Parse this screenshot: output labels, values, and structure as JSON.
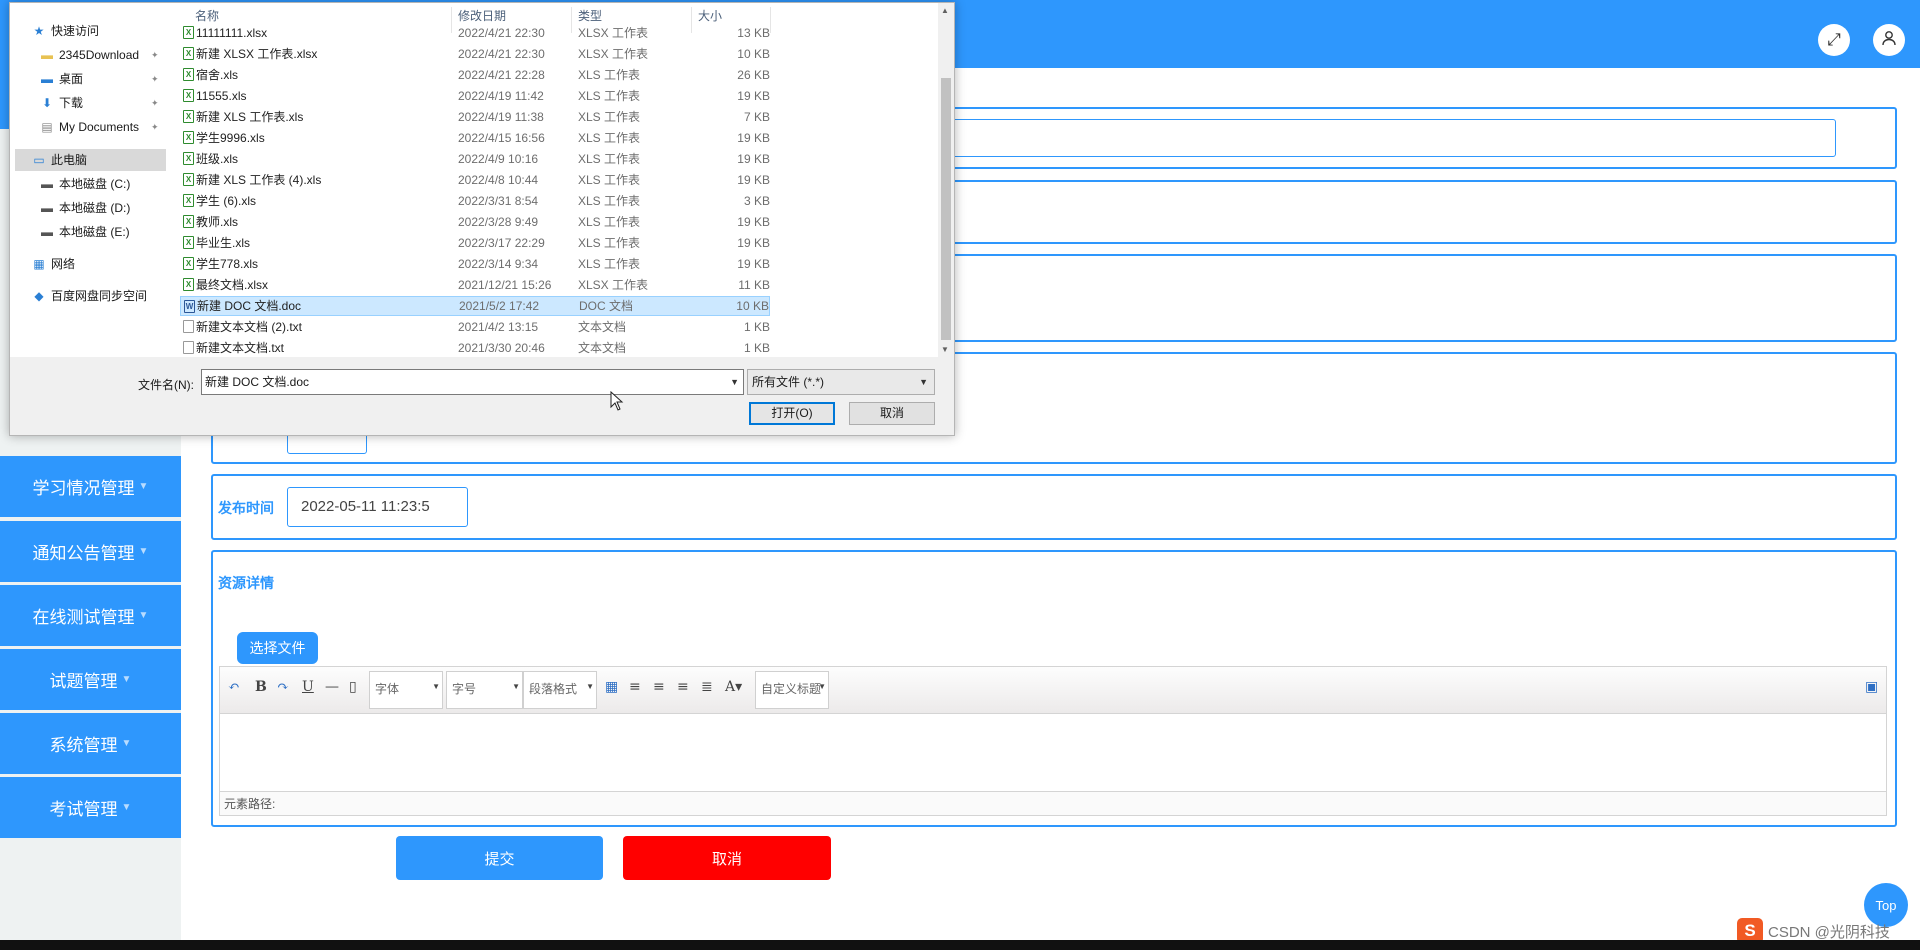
{
  "header": {
    "fullscreen_icon": "expand-icon",
    "user_icon": "user-icon"
  },
  "sidebar": {
    "items": [
      {
        "label": "学习情况管理"
      },
      {
        "label": "通知公告管理"
      },
      {
        "label": "在线测试管理"
      },
      {
        "label": "试题管理"
      },
      {
        "label": "系统管理"
      },
      {
        "label": "考试管理"
      }
    ]
  },
  "form": {
    "publish_time_label": "发布时间",
    "publish_time_value": "2022-05-11 11:23:5",
    "detail_label": "资源详情",
    "choose_file_label": "选择文件",
    "submit_label": "提交",
    "cancel_label": "取消"
  },
  "editor": {
    "font_family_placeholder": "字体",
    "font_size_placeholder": "字号",
    "paragraph_placeholder": "段落格式",
    "custom_title_placeholder": "自定义标题",
    "element_path_label": "元素路径:"
  },
  "top_button": "Top",
  "watermark": "CSDN @光阴科技",
  "dialog": {
    "nav": {
      "quick_access": "快速访问",
      "pinned": [
        "2345Download",
        "桌面",
        "下载",
        "My Documents"
      ],
      "this_pc": "此电脑",
      "drives": [
        "本地磁盘 (C:)",
        "本地磁盘 (D:)",
        "本地磁盘 (E:)"
      ],
      "network": "网络",
      "baidu": "百度网盘同步空间"
    },
    "columns": {
      "name": "名称",
      "date": "修改日期",
      "type": "类型",
      "size": "大小"
    },
    "files": [
      {
        "name": "11111111.xlsx",
        "date": "2022/4/21 22:30",
        "type": "XLSX 工作表",
        "size": "13 KB",
        "kind": "xlsx"
      },
      {
        "name": "新建 XLSX 工作表.xlsx",
        "date": "2022/4/21 22:30",
        "type": "XLSX 工作表",
        "size": "10 KB",
        "kind": "xlsx"
      },
      {
        "name": "宿舍.xls",
        "date": "2022/4/21 22:28",
        "type": "XLS 工作表",
        "size": "26 KB",
        "kind": "xls"
      },
      {
        "name": "11555.xls",
        "date": "2022/4/19 11:42",
        "type": "XLS 工作表",
        "size": "19 KB",
        "kind": "xls"
      },
      {
        "name": "新建 XLS 工作表.xls",
        "date": "2022/4/19 11:38",
        "type": "XLS 工作表",
        "size": "7 KB",
        "kind": "xls"
      },
      {
        "name": "学生9996.xls",
        "date": "2022/4/15 16:56",
        "type": "XLS 工作表",
        "size": "19 KB",
        "kind": "xls"
      },
      {
        "name": "班级.xls",
        "date": "2022/4/9 10:16",
        "type": "XLS 工作表",
        "size": "19 KB",
        "kind": "xls"
      },
      {
        "name": "新建 XLS 工作表 (4).xls",
        "date": "2022/4/8 10:44",
        "type": "XLS 工作表",
        "size": "19 KB",
        "kind": "xls"
      },
      {
        "name": "学生 (6).xls",
        "date": "2022/3/31 8:54",
        "type": "XLS 工作表",
        "size": "3 KB",
        "kind": "xls"
      },
      {
        "name": "教师.xls",
        "date": "2022/3/28 9:49",
        "type": "XLS 工作表",
        "size": "19 KB",
        "kind": "xls"
      },
      {
        "name": "毕业生.xls",
        "date": "2022/3/17 22:29",
        "type": "XLS 工作表",
        "size": "19 KB",
        "kind": "xls"
      },
      {
        "name": "学生778.xls",
        "date": "2022/3/14 9:34",
        "type": "XLS 工作表",
        "size": "19 KB",
        "kind": "xls"
      },
      {
        "name": "最终文档.xlsx",
        "date": "2021/12/21 15:26",
        "type": "XLSX 工作表",
        "size": "11 KB",
        "kind": "xlsx"
      },
      {
        "name": "新建 DOC 文档.doc",
        "date": "2021/5/2 17:42",
        "type": "DOC 文档",
        "size": "10 KB",
        "kind": "doc",
        "selected": true
      },
      {
        "name": "新建文本文档 (2).txt",
        "date": "2021/4/2 13:15",
        "type": "文本文档",
        "size": "1 KB",
        "kind": "txt"
      },
      {
        "name": "新建文本文档.txt",
        "date": "2021/3/30 20:46",
        "type": "文本文档",
        "size": "1 KB",
        "kind": "txt"
      }
    ],
    "filename_label": "文件名(N):",
    "filename_value": "新建 DOC 文档.doc",
    "filter_value": "所有文件 (*.*)",
    "open_label": "打开(O)",
    "cancel_label": "取消"
  },
  "colors": {
    "accent": "#2e97fd",
    "danger": "#ff0000",
    "selection": "#cce8ff"
  }
}
